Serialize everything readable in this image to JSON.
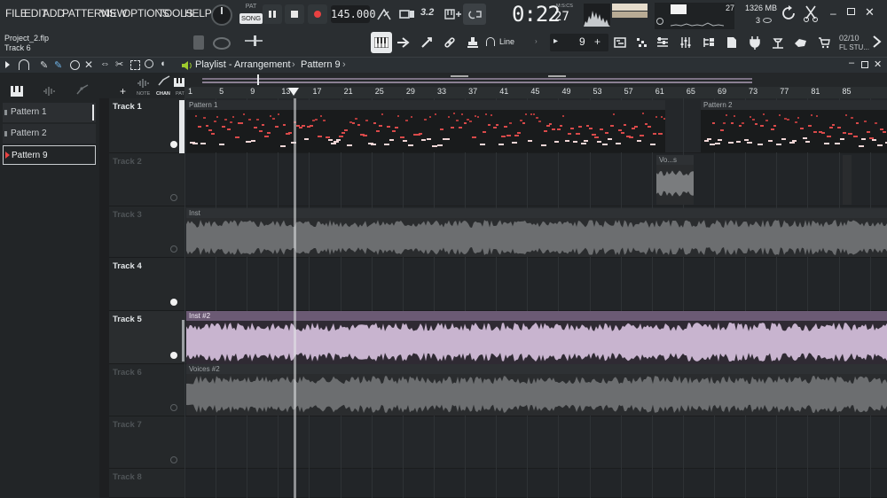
{
  "menu": [
    "FILE",
    "EDIT",
    "ADD",
    "PATTERNS",
    "VIEW",
    "OPTIONS",
    "TOOLS",
    "HELP"
  ],
  "transport": {
    "pat_label": "PAT",
    "song_label": "SONG",
    "tempo": "145.000",
    "time": "0:22",
    "time_cs": "27",
    "time_unit": "M:S:CS",
    "snap_label": "Line",
    "pattern_number": "9"
  },
  "meters": {
    "cpu_count": "27",
    "memory": "1326 MB",
    "polyphony": "3"
  },
  "project": {
    "filename": "Project_2.flp",
    "hint": "Track 6"
  },
  "news": {
    "date": "02/10",
    "label": "FL STU..."
  },
  "playlist": {
    "title": "Playlist - Arrangement",
    "pattern": "Pattern 9"
  },
  "sidebar": {
    "tabs": [
      "NOTE",
      "CHAN",
      "PAT"
    ],
    "patterns": [
      "Pattern 1",
      "Pattern 2",
      "Pattern 9"
    ],
    "selected": 2
  },
  "ruler": [
    "1",
    "5",
    "9",
    "13",
    "17",
    "21",
    "25",
    "29",
    "33",
    "37",
    "41",
    "45",
    "49",
    "53",
    "57",
    "61",
    "65",
    "69",
    "73",
    "77",
    "81",
    "85"
  ],
  "tracks": [
    "Track 1",
    "Track 2",
    "Track 3",
    "Track 4",
    "Track 5",
    "Track 6",
    "Track 7",
    "Track 8"
  ],
  "clips": {
    "pattern1": "Pattern 1",
    "pattern2": "Pattern 2",
    "voices_short": "Vo...s",
    "inst": "Inst",
    "inst2": "Inst #2",
    "voices2": "Voices #2"
  },
  "colors": {
    "accent_record": "#e84141",
    "pattern_clip": "#3a3d40",
    "inst2_clip": "#c8b4cf",
    "gray_audio": "#6c6e70",
    "selection_green": "#9ecb2d"
  }
}
